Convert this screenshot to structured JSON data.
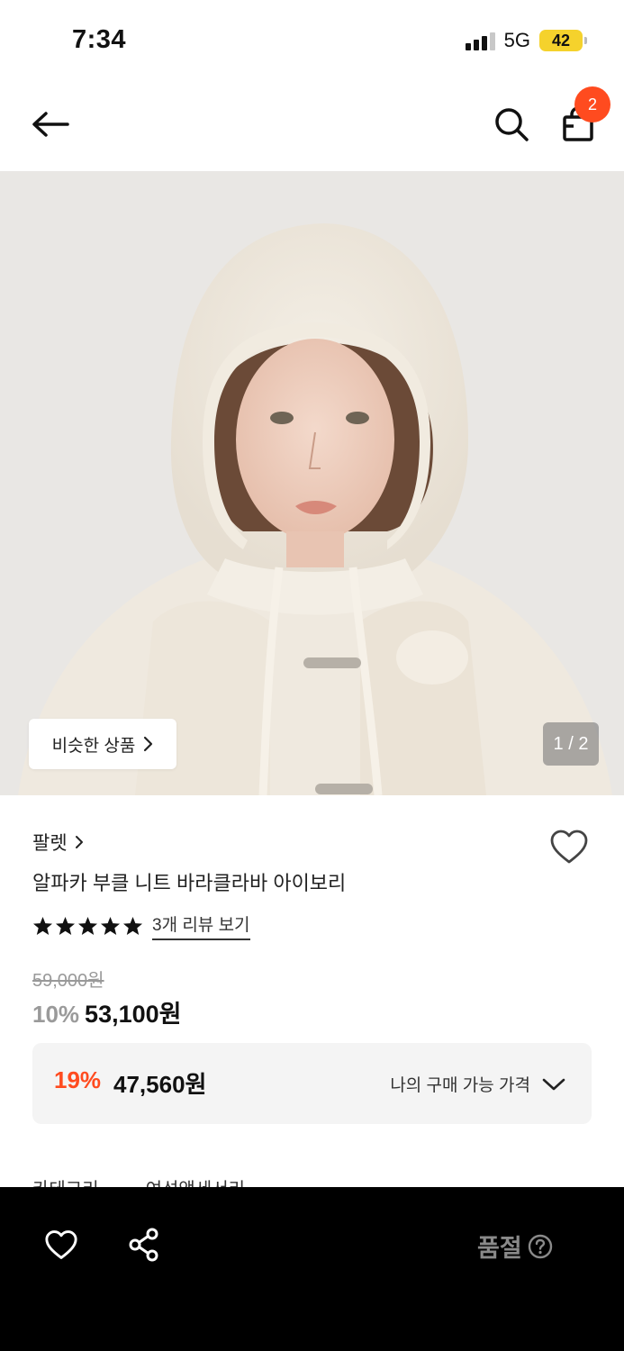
{
  "status_bar": {
    "time": "7:34",
    "network": "5G",
    "battery": "42"
  },
  "header": {
    "cart_count": "2"
  },
  "gallery": {
    "similar_label": "비슷한 상품",
    "page_indicator": "1 / 2"
  },
  "product": {
    "brand": "팔렛",
    "name": "알파카 부클 니트 바라클라바 아이보리",
    "rating_stars": 5,
    "review_link": "3개 리뷰 보기",
    "original_price": "59,000원",
    "discount_rate": "10%",
    "sale_price": "53,100원"
  },
  "my_price": {
    "rate": "19%",
    "price": "47,560원",
    "label": "나의 구매 가능 가격"
  },
  "peek": {
    "left": "카테고리",
    "right": "여성액세서리"
  },
  "bottom_bar": {
    "status": "품절"
  },
  "colors": {
    "accent": "#ff4b1f",
    "soldout_text": "#8a8a8a",
    "bottom_bg": "#000000"
  },
  "icons": [
    "back-arrow-icon",
    "search-icon",
    "shopping-bag-icon",
    "chevron-right-icon",
    "heart-icon",
    "star-icon",
    "chevron-down-icon",
    "share-icon",
    "question-icon"
  ]
}
